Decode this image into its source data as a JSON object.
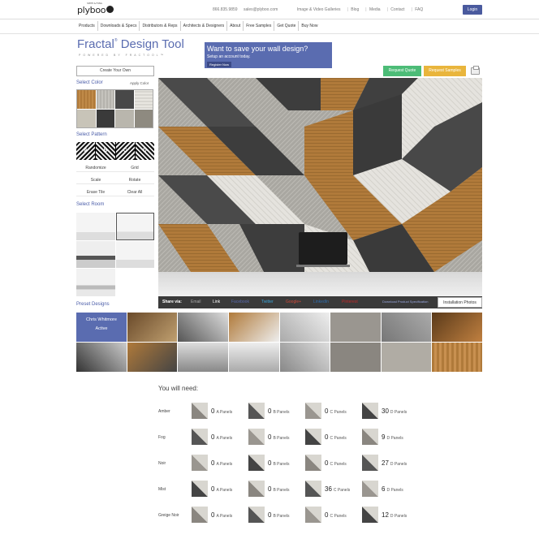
{
  "header": {
    "logo": "plyboo",
    "logo_small": "SMITH & FONG",
    "phone": "866.835.9859",
    "email": "sales@plyboo.com",
    "links": [
      "Image & Video Galleries",
      "Blog",
      "Media",
      "Contact",
      "FAQ"
    ],
    "login": "Login"
  },
  "nav": [
    "Products",
    "Downloads & Specs",
    "Distributors & Reps",
    "Architects & Designers",
    "About",
    "Free Samples",
    "Get Quote",
    "Buy Now"
  ],
  "tool": {
    "title": "Fractal",
    "title_rest": "Design Tool",
    "powered": "POWERED BY FRACTOOL™"
  },
  "promo": {
    "headline": "Want to save your wall design?",
    "sub": "Setup an account today.",
    "button": "Register Now"
  },
  "actions": {
    "request_quote": "Request Quote",
    "request_samples": "Request Samples"
  },
  "sidebar": {
    "create": "Create Your Own",
    "select_color": "Select Color",
    "apply_color": "Apply Color",
    "select_pattern": "Select Pattern",
    "pattern_letters": [
      "A",
      "B",
      "C",
      "D"
    ],
    "controls": [
      "Randomize",
      "Grid",
      "Scale",
      "Rotate",
      "Erase Tile",
      "Clear All"
    ],
    "select_room": "Select Room"
  },
  "swatch_colors": [
    "#b07a3a",
    "#b5b3ad",
    "#484848",
    "#d8d6d0",
    "#c8c4b8",
    "#3a3a3a",
    "#b9b6ad",
    "#8e8a80"
  ],
  "share": {
    "label": "Share via:",
    "items": [
      "Email",
      "Link",
      "Facebook",
      "Twitter",
      "Google+",
      "LinkedIn",
      "Pinterest"
    ],
    "download": "Download Product Specification",
    "install": "Installation Photos"
  },
  "presets": {
    "label": "Preset Designs",
    "active_name": "Chris Whitmore",
    "active_label": "Active"
  },
  "need": {
    "title": "You will need:",
    "rows": [
      {
        "name": "Amber",
        "counts": [
          "0",
          "0",
          "0",
          "30"
        ]
      },
      {
        "name": "Fog",
        "counts": [
          "0",
          "0",
          "0",
          "9"
        ]
      },
      {
        "name": "Noir",
        "counts": [
          "0",
          "0",
          "0",
          "27"
        ]
      },
      {
        "name": "Mist",
        "counts": [
          "0",
          "0",
          "36",
          "6"
        ]
      },
      {
        "name": "Greige Noir",
        "counts": [
          "0",
          "0",
          "0",
          "12"
        ]
      }
    ],
    "panel_labels": [
      "A Panels",
      "B Panels",
      "C Panels",
      "D Panels"
    ]
  }
}
